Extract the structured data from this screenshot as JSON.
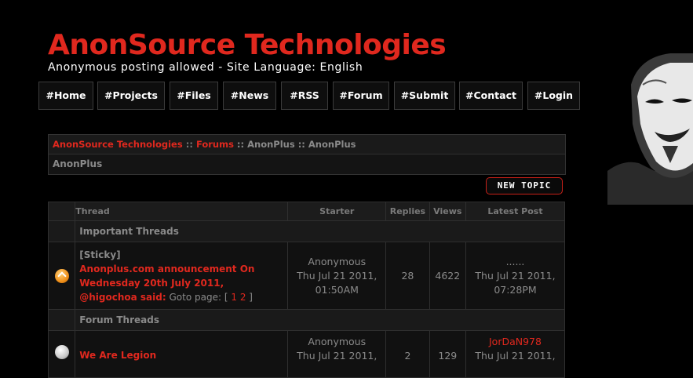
{
  "site": {
    "title": "AnonSource Technologies",
    "tagline": "Anonymous posting allowed - Site Language: English"
  },
  "nav": [
    "#Home",
    "#Projects",
    "#Files",
    "#News",
    "#RSS",
    "#Forum",
    "#Submit",
    "#Contact",
    "#Login"
  ],
  "breadcrumb": {
    "site": "AnonSource Technologies",
    "sep1": " :: ",
    "forums": "Forums",
    "rest": " :: AnonPlus :: AnonPlus",
    "subtitle": "AnonPlus"
  },
  "new_topic_label": "NEW TOPIC",
  "table": {
    "headers": {
      "thread": "Thread",
      "starter": "Starter",
      "replies": "Replies",
      "views": "Views",
      "latest": "Latest Post"
    },
    "important_label": "Important Threads",
    "forum_label": "Forum Threads",
    "sticky": {
      "tag": "[Sticky]",
      "title": "Anonplus.com announcement On Wednesday 20th July 2011, @higochoa said:",
      "goto": "Goto page: [",
      "page1": "1",
      "page2": "2",
      "close": "]",
      "starter": "Anonymous",
      "starter_date": "Thu Jul 21 2011, 01:50AM",
      "replies": "28",
      "views": "4622",
      "latest_by": "......",
      "latest_date": "Thu Jul 21 2011, 07:28PM"
    },
    "thread2": {
      "title": "We Are Legion",
      "starter": "Anonymous",
      "starter_date": "Thu Jul 21 2011,",
      "replies": "2",
      "views": "129",
      "latest_by": "JorDaN978",
      "latest_date": "Thu Jul 21 2011,"
    }
  }
}
